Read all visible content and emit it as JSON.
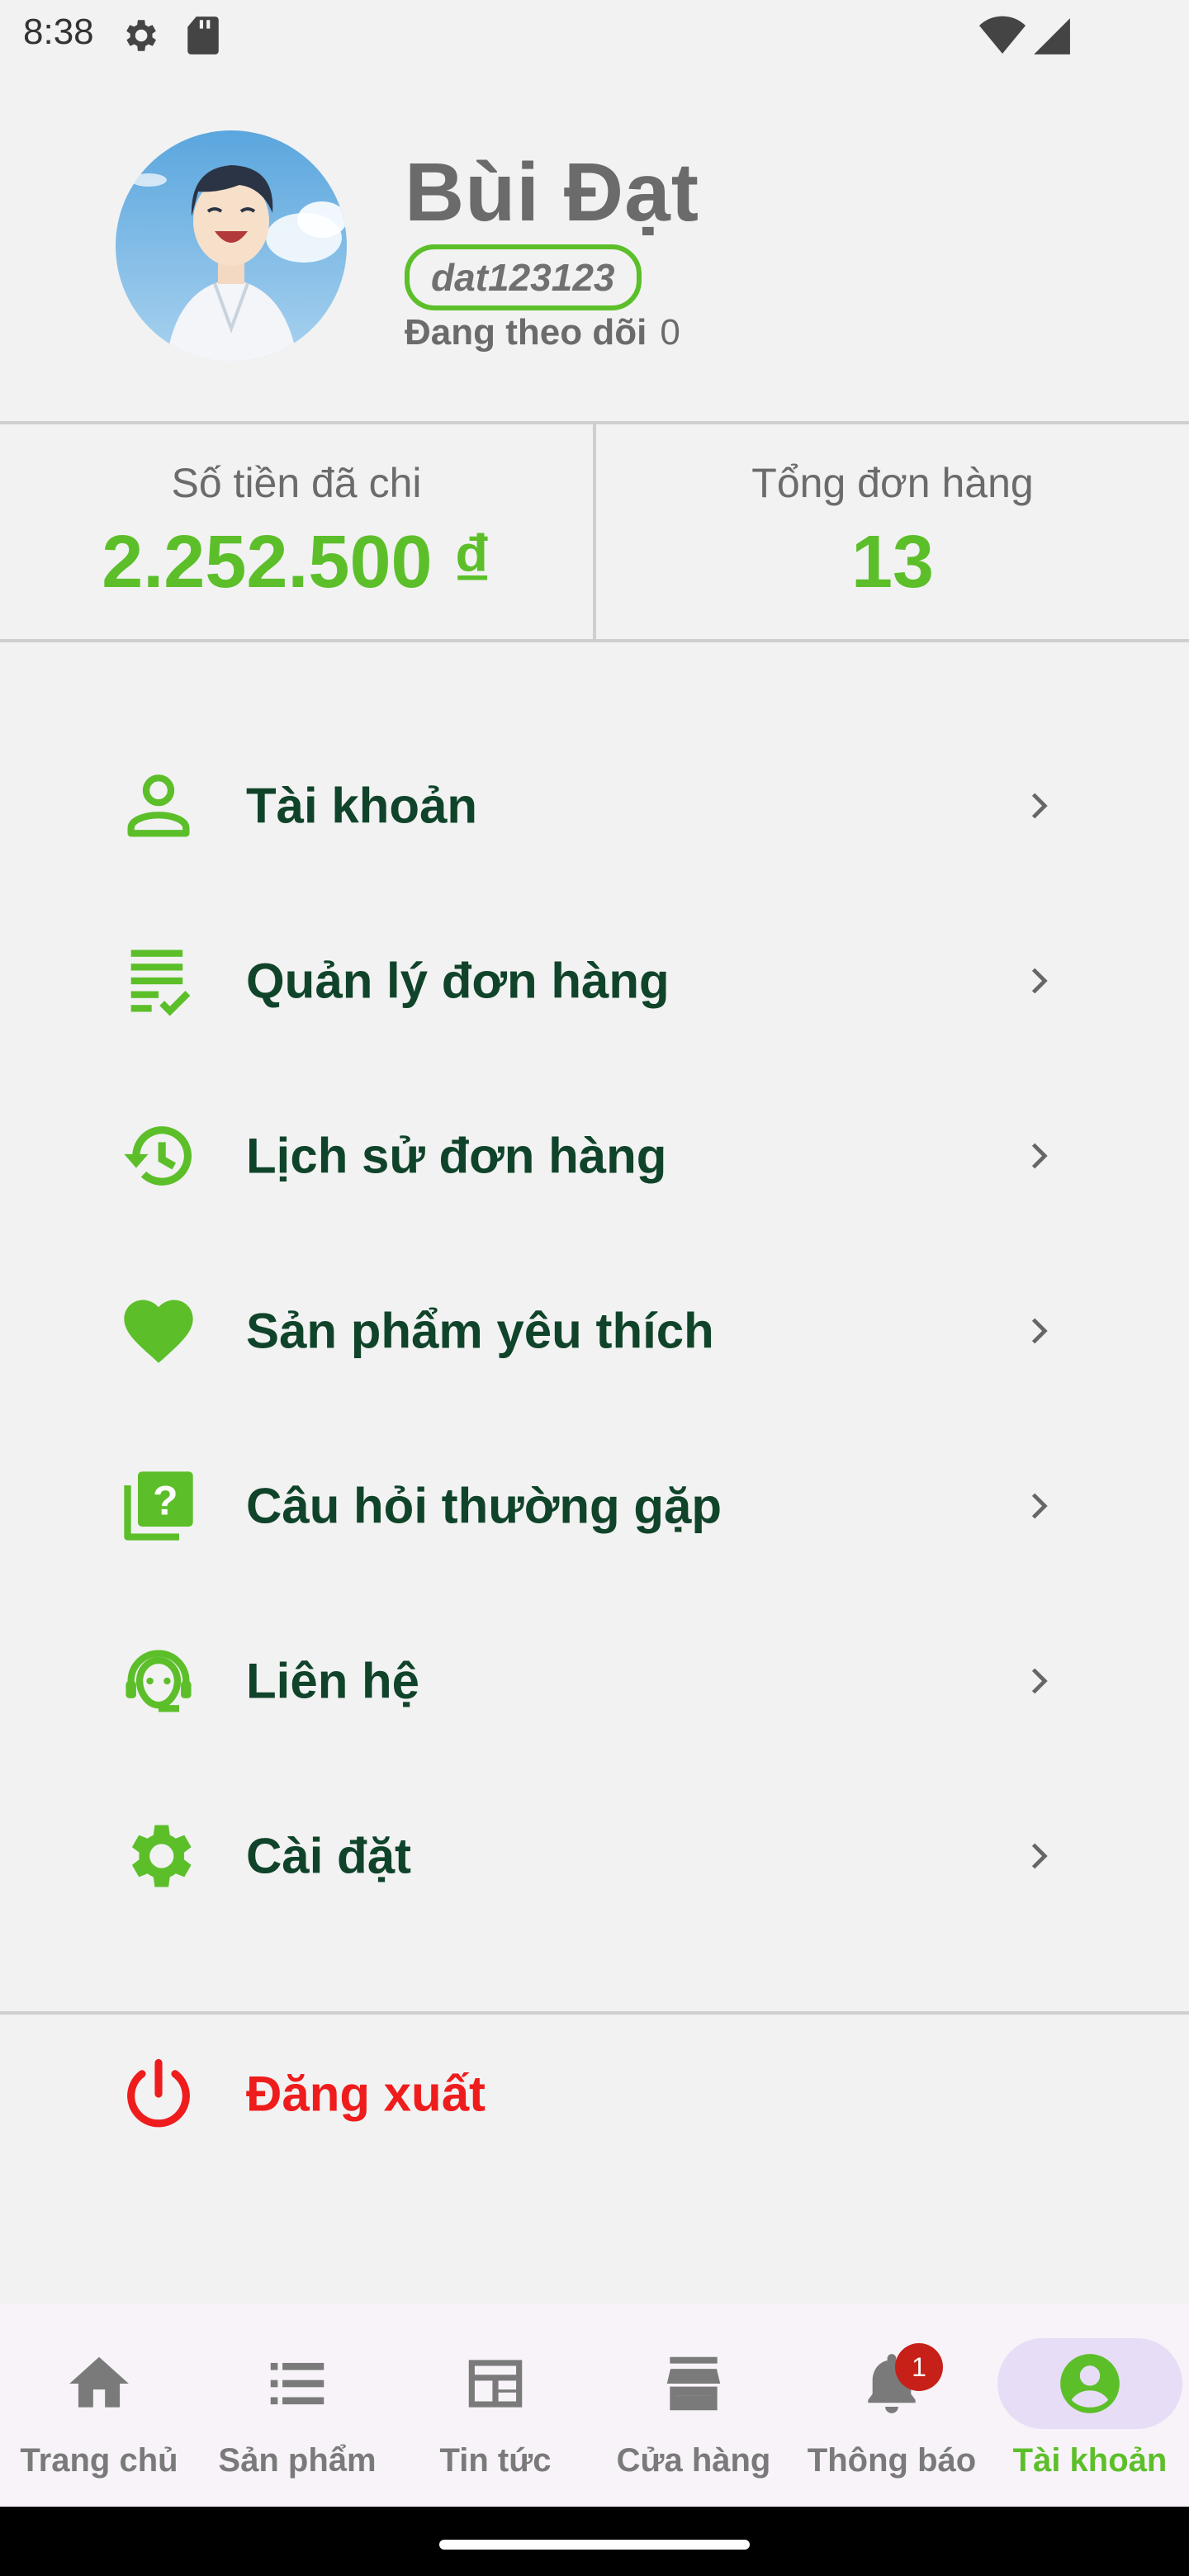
{
  "status_bar": {
    "time": "8:38",
    "icons": [
      "settings-icon",
      "sd-card-icon",
      "wifi-icon",
      "cellular-signal-icon"
    ]
  },
  "profile": {
    "name": "Bùi Đạt",
    "username": "dat123123",
    "following_label": "Đang theo dõi",
    "following_count": "0"
  },
  "stats": {
    "spent_label": "Số tiền đã chi",
    "spent_value": "2.252.500 ₫",
    "orders_label": "Tổng đơn hàng",
    "orders_value": "13"
  },
  "menu": [
    {
      "label": "Tài khoản",
      "icon": "person-icon"
    },
    {
      "label": "Quản lý đơn hàng",
      "icon": "order-checklist-icon"
    },
    {
      "label": "Lịch sử đơn hàng",
      "icon": "history-icon"
    },
    {
      "label": "Sản phẩm yêu thích",
      "icon": "heart-icon"
    },
    {
      "label": "Câu hỏi thường gặp",
      "icon": "faq-icon"
    },
    {
      "label": "Liên hệ",
      "icon": "support-agent-icon"
    },
    {
      "label": "Cài đặt",
      "icon": "gear-icon"
    }
  ],
  "logout": {
    "label": "Đăng xuất",
    "icon": "power-icon"
  },
  "bottom_nav": {
    "items": [
      {
        "label": "Trang chủ",
        "icon": "home-icon"
      },
      {
        "label": "Sản phẩm",
        "icon": "list-icon"
      },
      {
        "label": "Tin tức",
        "icon": "newspaper-icon"
      },
      {
        "label": "Cửa hàng",
        "icon": "store-icon"
      },
      {
        "label": "Thông báo",
        "icon": "bell-icon"
      },
      {
        "label": "Tài khoản",
        "icon": "account-circle-icon"
      }
    ],
    "notification_badge": "1",
    "active_index": 5
  },
  "colors": {
    "accent_green": "#5cbf2a",
    "menu_text": "#10442a",
    "logout_red": "#ee1c1c",
    "background": "#f2f2f2"
  }
}
